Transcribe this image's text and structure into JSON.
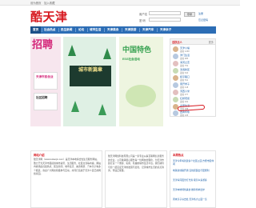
{
  "topbar": {
    "link1": "设为首页",
    "link2": "加入收藏"
  },
  "logo": {
    "text": "酷天津"
  },
  "login": {
    "user_label": "用户名",
    "pass_label": "密 码",
    "login_button": "登录",
    "register_link": "注册",
    "forgot_link": "忘记密码"
  },
  "nav": {
    "items": [
      "首页",
      "社会热点",
      "民生新闻",
      "论坛",
      "城市生活",
      "天津美食",
      "天津旅游",
      "天津汽车",
      "天津亲子"
    ]
  },
  "banners": {
    "b1_title": "招聘",
    "b1_sub1": "天津市民创业",
    "b1_sub2": "社区招聘",
    "b2_title": "城市新篇章",
    "b3_title": "中国特色",
    "b3_sub": "ESG社会活动"
  },
  "side": {
    "header": "活跃达人",
    "more": "更多",
    "users": [
      {
        "name": "天津小编",
        "desc": "发帖 1268"
      },
      {
        "name": "津门生活",
        "desc": "发帖 986"
      },
      {
        "name": "海河之恋",
        "desc": "发帖 752"
      },
      {
        "name": "滨海新区",
        "desc": "发帖 640"
      },
      {
        "name": "和平路口",
        "desc": "发帖 531"
      },
      {
        "name": "南开学子",
        "desc": "发帖 418"
      },
      {
        "name": "河西小米",
        "desc": "发帖 377"
      },
      {
        "name": "红桥老街",
        "desc": "发帖 302"
      },
      {
        "name": "北辰生活",
        "desc": "发帖 288"
      },
      {
        "name": "西青印象",
        "desc": "发帖 245"
      }
    ]
  },
  "boxes": {
    "left_title": "网站介绍",
    "left_text": "酷天津网（www.kutianjin.com）是天津本地综合性生活服务网站，致力于为天津市民提供城市资讯、生活服务、社区交流等内容。网站内容涵盖社会热点、民生新闻、城市生活、美食旅游、汽车亲子等多个频道，欢迎广大网友积极参与互动，共同打造属于天津人自己的网络家园。",
    "mid_title": "",
    "mid_text": "酷天津网络科技有限公司是一家专业从事互联网信息服务的企业，公司秉承用心服务每一位网友的理念，为天津市民打造一个便捷、实用、有趣的城市生活平台。我们期待与您一起见证天津的发展与变化，记录城市生活的点点滴滴，传递正能量。",
    "right_title": "本周热点",
    "right_items": [
      "天津今年将新建多个社区公园 方便市民休闲",
      "地铁新线路开通 沿线居民出行更便利",
      "天津海河夜景灯光秀 吸引众多游客",
      "天津本地特色美食 推荐榜单出炉",
      "周末亲子好去处 天津各大公园一览"
    ]
  }
}
